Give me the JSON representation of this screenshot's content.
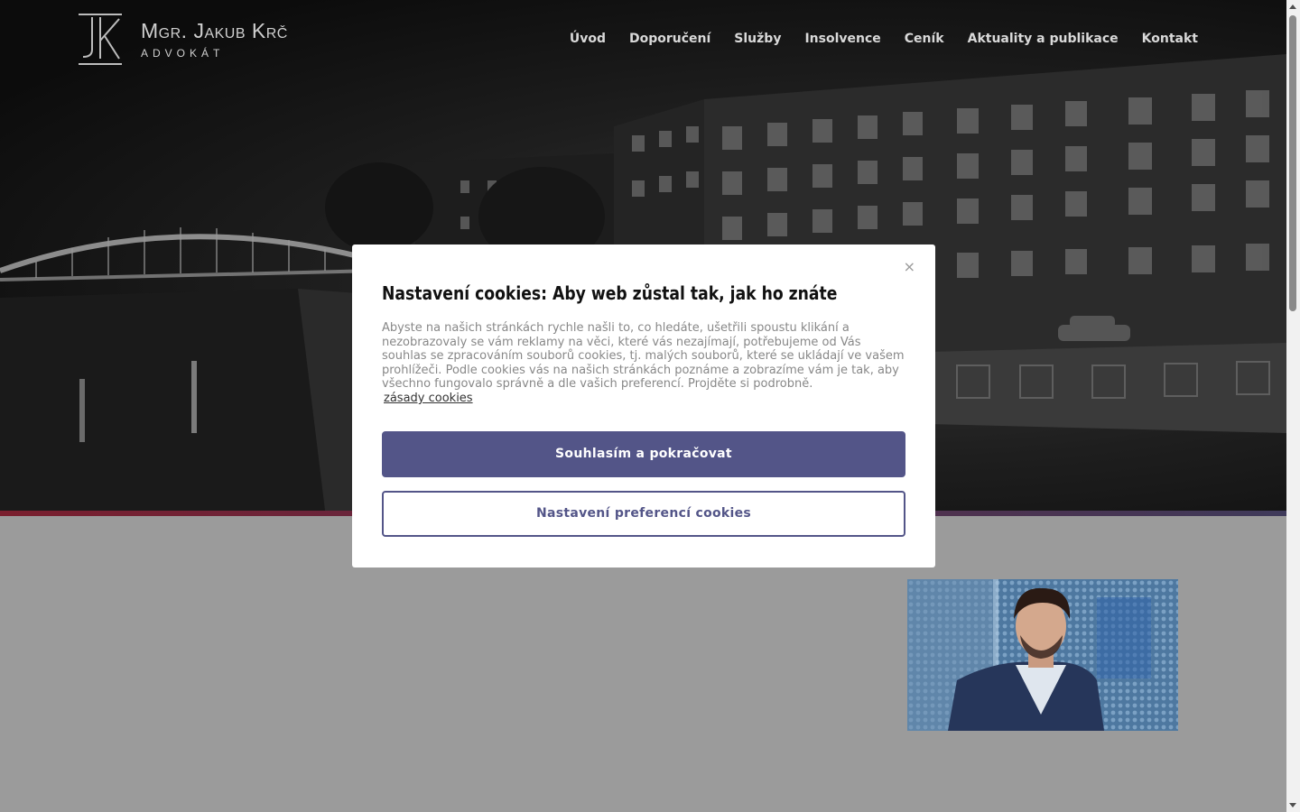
{
  "header": {
    "logo_name": "Mgr. Jakub Krč",
    "logo_sub": "ADVOKÁT",
    "nav": [
      {
        "label": "Úvod"
      },
      {
        "label": "Doporučení"
      },
      {
        "label": "Služby"
      },
      {
        "label": "Insolvence"
      },
      {
        "label": "Ceník"
      },
      {
        "label": "Aktuality a publikace"
      },
      {
        "label": "Kontakt"
      }
    ]
  },
  "cookie_modal": {
    "close_label": "×",
    "title": "Nastavení cookies: Aby web zůstal tak, jak ho znáte",
    "text": "Abyste na našich stránkách rychle našli to, co hledáte, ušetřili spoustu klikání a nezobrazovaly se vám reklamy na věci, které vás nezajímají, potřebujeme od Vás souhlas se zpracováním souborů cookies, tj. malých souborů, které se ukládají ve vašem prohlížeči. Podle cookies vás na našich stránkách poznáme a zobrazíme vám je tak, aby všechno fungovalo správně a dle vašich preferencí. Projděte si podrobně.",
    "link_label": "zásady cookies",
    "accept_label": "Souhlasím a pokračovat",
    "preferences_label": "Nastavení preferencí cookies"
  },
  "colors": {
    "primary": "#535588",
    "hero_stripe_left": "#7a1f2e",
    "hero_stripe_right": "#3f3a5a",
    "content_bg": "#9b9b9b"
  }
}
